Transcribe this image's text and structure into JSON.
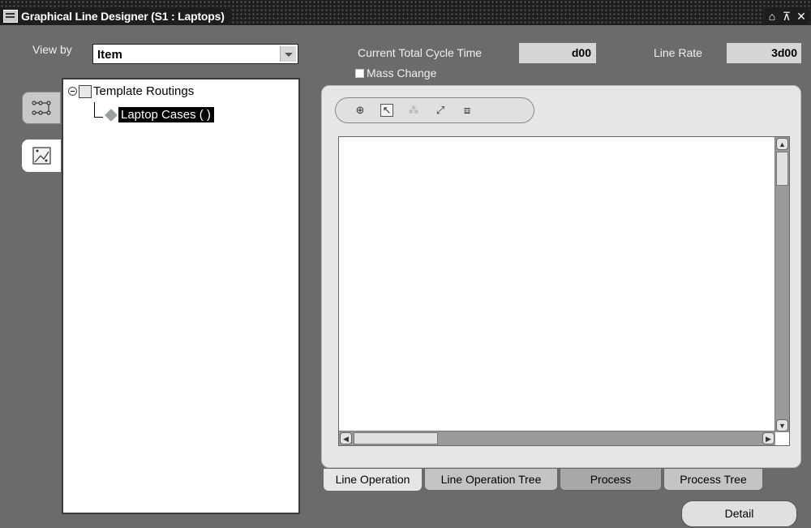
{
  "window": {
    "title": "Graphical Line Designer (S1 : Laptops)",
    "controls": [
      "minimize-icon",
      "restore-icon",
      "close-icon"
    ],
    "control_glyphs": [
      "⌂",
      "⊼",
      "✕"
    ]
  },
  "view_by": {
    "label": "View by",
    "value": "Item"
  },
  "side_tabs": [
    {
      "icon": "line-operations-icon"
    },
    {
      "icon": "routings-diagram-icon"
    }
  ],
  "tree": {
    "root_label": "Template Routings",
    "child_label": "Laptop Cases ( )"
  },
  "header": {
    "cycle_time_label": "Current Total Cycle Time",
    "cycle_time_value": "d00",
    "line_rate_label": "Line Rate",
    "line_rate_value": "3d00"
  },
  "mass_change": {
    "label": "Mass Change",
    "checked": false
  },
  "toolbar": {
    "tools": [
      {
        "name": "globe-icon",
        "glyph": "⊕",
        "enabled": true
      },
      {
        "name": "pointer-icon",
        "glyph": "↖",
        "enabled": true
      },
      {
        "name": "network-icon",
        "glyph": "⁂",
        "enabled": false
      },
      {
        "name": "connect-icon",
        "glyph": "⤢",
        "enabled": true
      },
      {
        "name": "frame-icon",
        "glyph": "⧈",
        "enabled": true
      }
    ]
  },
  "bottom_tabs": [
    "Line Operation",
    "Line Operation Tree",
    "Process",
    "Process Tree"
  ],
  "active_tab": "Line Operation",
  "detail_button": "Detail",
  "colors": {
    "background": "#6b6b6b",
    "titlebar": "#1e1e1e",
    "panel": "#e6e6e6"
  }
}
